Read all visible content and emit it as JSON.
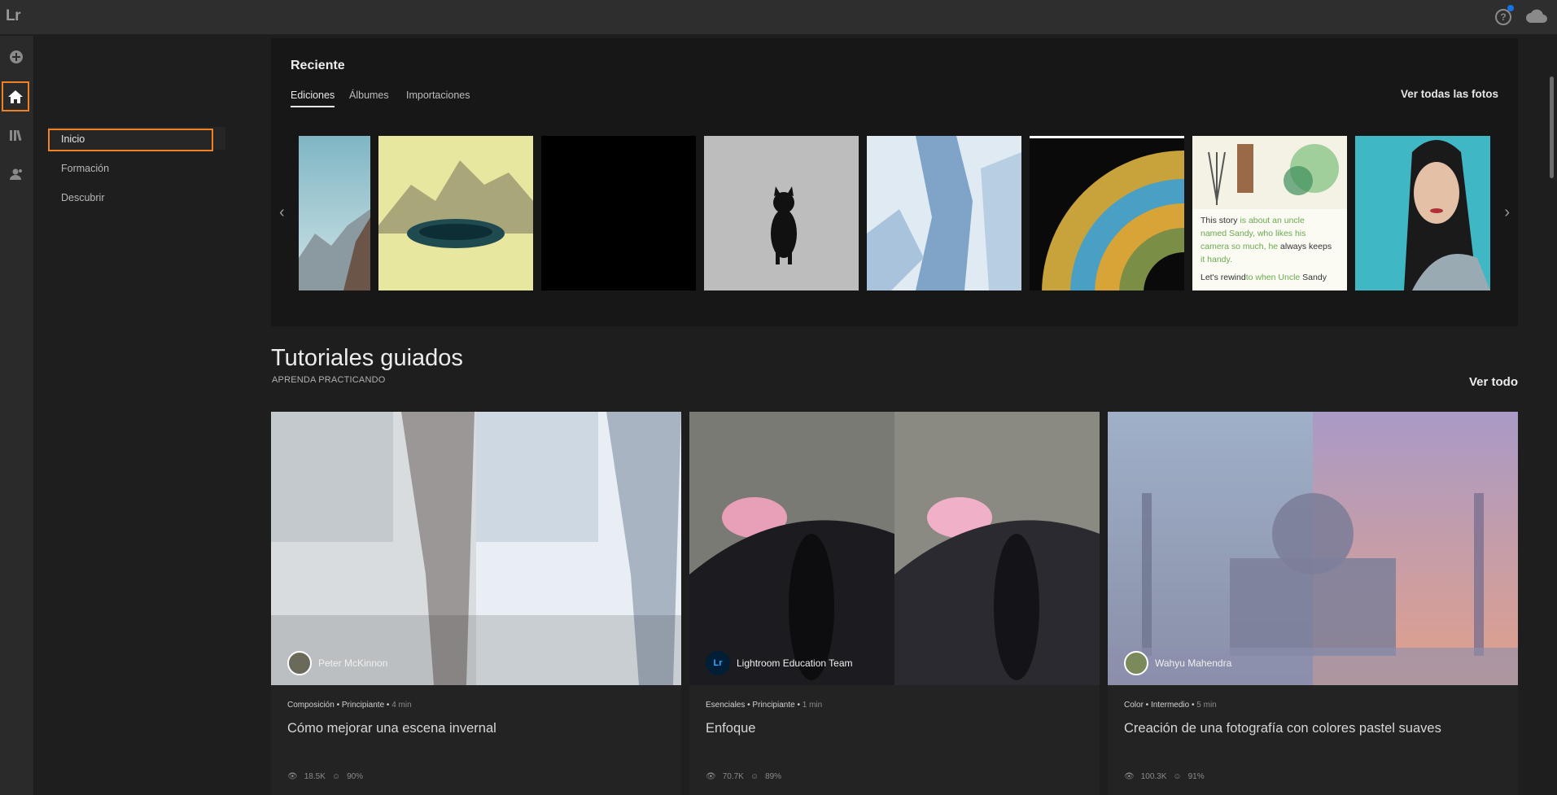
{
  "app": {
    "logo": "Lr"
  },
  "sidebar": {
    "items": [
      {
        "label": "Inicio"
      },
      {
        "label": "Formación"
      },
      {
        "label": "Descubrir"
      }
    ]
  },
  "recent": {
    "title": "Reciente",
    "tabs": [
      "Ediciones",
      "Álbumes",
      "Importaciones"
    ],
    "see_all": "Ver todas las fotos",
    "story_text": {
      "l1a": "This story ",
      "l1b": "is about ",
      "l1c": "an uncle",
      "l2a": "named Sandy, who likes his",
      "l3a": "camera so much, he ",
      "l3b": "always keeps",
      "l4a": "it handy.",
      "l5a": "Let's rewind ",
      "l5b": "to when Uncle ",
      "l5c": "Sandy"
    }
  },
  "tutorials": {
    "title": "Tutoriales guiados",
    "subtitle": "APRENDA PRACTICANDO",
    "see_all": "Ver todo",
    "cards": [
      {
        "author": "Peter McKinnon",
        "category": "Composición",
        "level": "Principiante",
        "duration": "4 min",
        "title": "Cómo mejorar una escena invernal",
        "views": "18.5K",
        "rating": "90%"
      },
      {
        "author": "Lightroom Education Team",
        "author_badge": "Lr",
        "category": "Esenciales",
        "level": "Principiante",
        "duration": "1 min",
        "title": "Enfoque",
        "views": "70.7K",
        "rating": "89%"
      },
      {
        "author": "Wahyu Mahendra",
        "category": "Color",
        "level": "Intermedio",
        "duration": "5 min",
        "title": "Creación de una fotografía con colores pastel suaves",
        "views": "100.3K",
        "rating": "91%"
      }
    ]
  },
  "colors": {
    "accent": "#f28125",
    "notification": "#1473e6"
  }
}
